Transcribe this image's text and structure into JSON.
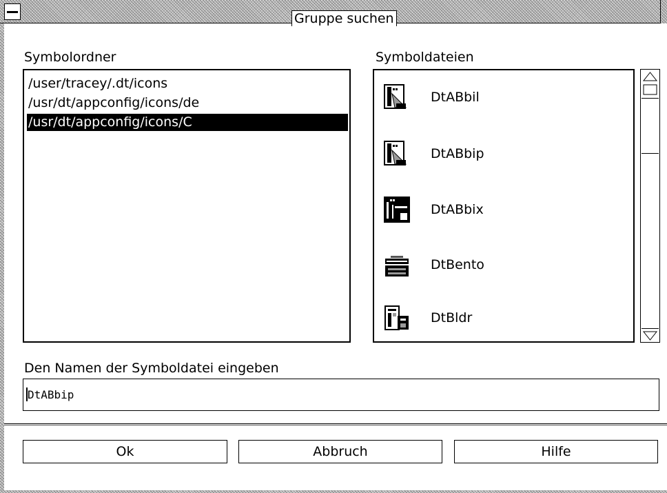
{
  "window": {
    "title": "Gruppe suchen"
  },
  "folders": {
    "label": "Symbolordner",
    "items": [
      "/user/tracey/.dt/icons",
      "/usr/dt/appconfig/icons/de",
      "/usr/dt/appconfig/icons/C"
    ],
    "selected_index": 2
  },
  "icons": {
    "label": "Symboldateien",
    "items": [
      {
        "name": "DtABbil",
        "icon": "app-builder-icon"
      },
      {
        "name": "DtABbip",
        "icon": "app-builder-icon"
      },
      {
        "name": "DtABbix",
        "icon": "app-builder-inverse-icon"
      },
      {
        "name": "DtBento",
        "icon": "bento-box-icon"
      },
      {
        "name": "DtBldr",
        "icon": "builder-icon"
      }
    ]
  },
  "filename": {
    "label": "Den Namen der Symboldatei eingeben",
    "value": "DtABbip"
  },
  "buttons": {
    "ok": "Ok",
    "cancel": "Abbruch",
    "help": "Hilfe"
  }
}
